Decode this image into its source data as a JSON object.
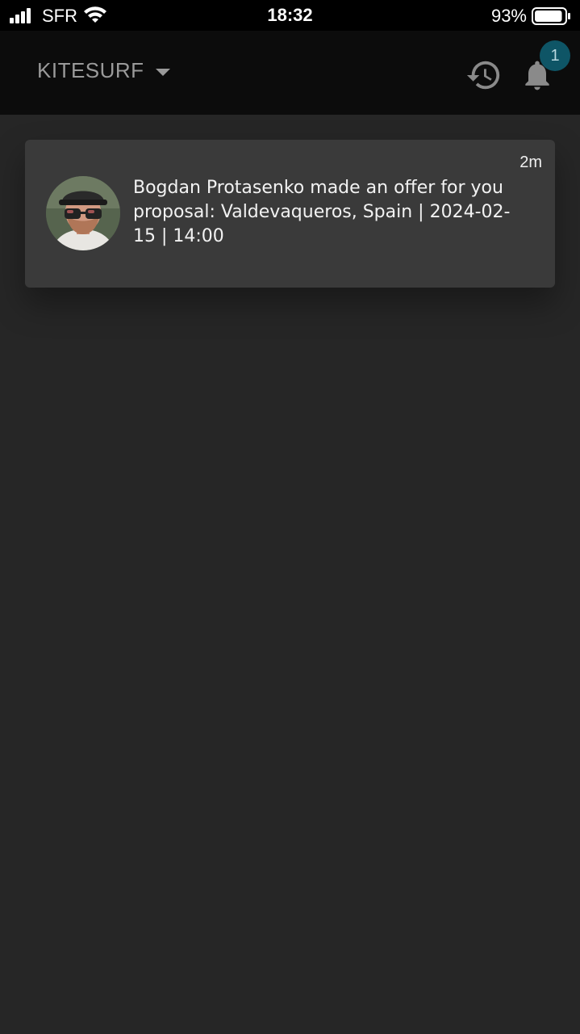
{
  "status_bar": {
    "carrier": "SFR",
    "time": "18:32",
    "battery_percent": "93%",
    "battery_level": 0.93,
    "signal_icon": "signal-bars-icon",
    "wifi_icon": "wifi-icon"
  },
  "header": {
    "category": "KITESURF",
    "dropdown_icon": "caret-down-icon",
    "history_icon": "history-icon",
    "notifications_icon": "bell-icon",
    "notification_count": "1"
  },
  "notifications": [
    {
      "avatar_icon": "user-avatar",
      "message": "Bogdan Protasenko made an offer for you proposal: Valdevaqueros, Spain | 2024-02-15 | 14:00",
      "time": "2m"
    }
  ],
  "colors": {
    "background": "#262626",
    "header": "#0c0c0c",
    "card": "#3a3a3a",
    "badge": "#0e5566"
  }
}
